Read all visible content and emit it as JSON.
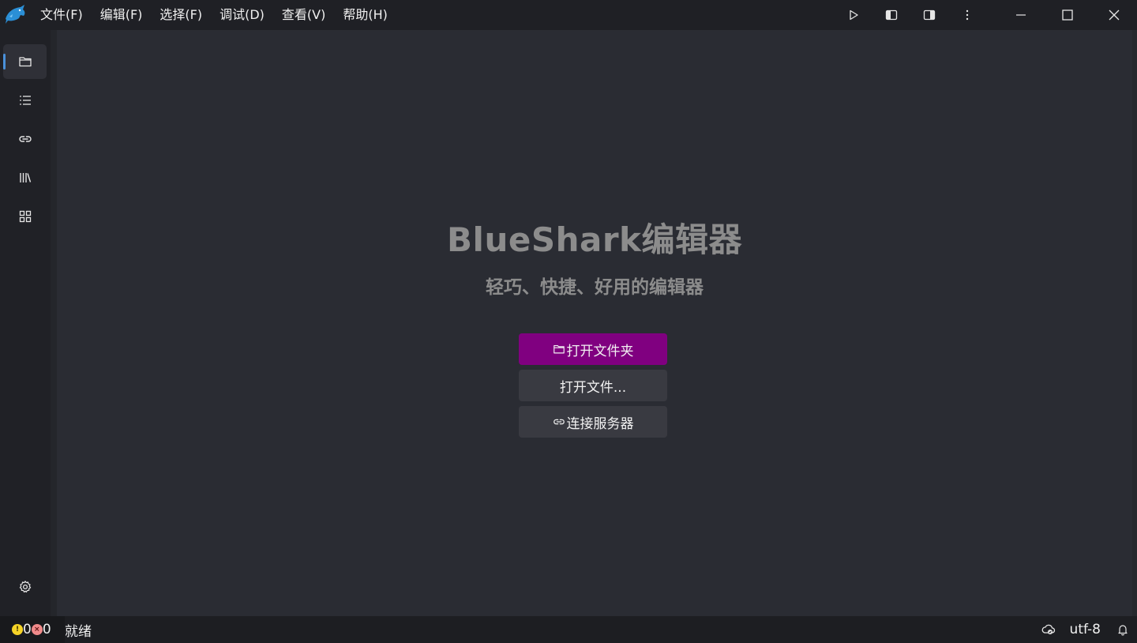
{
  "menu": {
    "items": [
      {
        "label": "文件(F)"
      },
      {
        "label": "编辑(F)"
      },
      {
        "label": "选择(F)"
      },
      {
        "label": "调试(D)"
      },
      {
        "label": "查看(V)"
      },
      {
        "label": "帮助(H)"
      }
    ]
  },
  "welcome": {
    "title": "BlueShark编辑器",
    "subtitle": "轻巧、快捷、好用的编辑器",
    "open_folder_label": "打开文件夹",
    "open_file_label": "打开文件...",
    "connect_server_label": "连接服务器"
  },
  "status": {
    "warning_count": "0",
    "error_count": "0",
    "state": "就绪",
    "encoding": "utf-8"
  },
  "colors": {
    "accent": "#800080",
    "active_indicator": "#4a90d9",
    "logo": "#2b8fd6",
    "warning": "#f5d327",
    "error": "#f08a8a"
  },
  "icons": {
    "activity_bar": [
      "folder-icon",
      "list-icon",
      "link-icon",
      "library-icon",
      "grid-icon",
      "gear-icon"
    ],
    "title_actions": [
      "run-icon",
      "toggle-left-panel-icon",
      "toggle-right-panel-icon",
      "more-vertical-icon"
    ],
    "window_controls": [
      "minimize-icon",
      "maximize-icon",
      "close-icon"
    ],
    "status_right": [
      "remote-icon",
      "bell-icon"
    ]
  }
}
